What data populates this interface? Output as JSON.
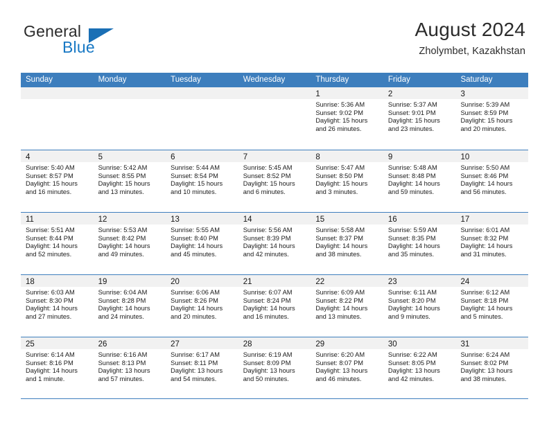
{
  "brand": {
    "name_part1": "General",
    "name_part2": "Blue",
    "logo_icon": "triangle-flag-icon",
    "blue": "#1878c4"
  },
  "header": {
    "title": "August 2024",
    "location": "Zholymbet, Kazakhstan"
  },
  "theme": {
    "header_blue": "#3d7ebd",
    "datebar_gray": "#f1f1f1",
    "text": "#1a1a1a"
  },
  "day_headers": [
    "Sunday",
    "Monday",
    "Tuesday",
    "Wednesday",
    "Thursday",
    "Friday",
    "Saturday"
  ],
  "weeks": [
    [
      {
        "day": "",
        "empty": true
      },
      {
        "day": "",
        "empty": true
      },
      {
        "day": "",
        "empty": true
      },
      {
        "day": "",
        "empty": true
      },
      {
        "day": "1",
        "sunrise": "Sunrise: 5:36 AM",
        "sunset": "Sunset: 9:02 PM",
        "daylight1": "Daylight: 15 hours",
        "daylight2": "and 26 minutes."
      },
      {
        "day": "2",
        "sunrise": "Sunrise: 5:37 AM",
        "sunset": "Sunset: 9:01 PM",
        "daylight1": "Daylight: 15 hours",
        "daylight2": "and 23 minutes."
      },
      {
        "day": "3",
        "sunrise": "Sunrise: 5:39 AM",
        "sunset": "Sunset: 8:59 PM",
        "daylight1": "Daylight: 15 hours",
        "daylight2": "and 20 minutes."
      }
    ],
    [
      {
        "day": "4",
        "sunrise": "Sunrise: 5:40 AM",
        "sunset": "Sunset: 8:57 PM",
        "daylight1": "Daylight: 15 hours",
        "daylight2": "and 16 minutes."
      },
      {
        "day": "5",
        "sunrise": "Sunrise: 5:42 AM",
        "sunset": "Sunset: 8:55 PM",
        "daylight1": "Daylight: 15 hours",
        "daylight2": "and 13 minutes."
      },
      {
        "day": "6",
        "sunrise": "Sunrise: 5:44 AM",
        "sunset": "Sunset: 8:54 PM",
        "daylight1": "Daylight: 15 hours",
        "daylight2": "and 10 minutes."
      },
      {
        "day": "7",
        "sunrise": "Sunrise: 5:45 AM",
        "sunset": "Sunset: 8:52 PM",
        "daylight1": "Daylight: 15 hours",
        "daylight2": "and 6 minutes."
      },
      {
        "day": "8",
        "sunrise": "Sunrise: 5:47 AM",
        "sunset": "Sunset: 8:50 PM",
        "daylight1": "Daylight: 15 hours",
        "daylight2": "and 3 minutes."
      },
      {
        "day": "9",
        "sunrise": "Sunrise: 5:48 AM",
        "sunset": "Sunset: 8:48 PM",
        "daylight1": "Daylight: 14 hours",
        "daylight2": "and 59 minutes."
      },
      {
        "day": "10",
        "sunrise": "Sunrise: 5:50 AM",
        "sunset": "Sunset: 8:46 PM",
        "daylight1": "Daylight: 14 hours",
        "daylight2": "and 56 minutes."
      }
    ],
    [
      {
        "day": "11",
        "sunrise": "Sunrise: 5:51 AM",
        "sunset": "Sunset: 8:44 PM",
        "daylight1": "Daylight: 14 hours",
        "daylight2": "and 52 minutes."
      },
      {
        "day": "12",
        "sunrise": "Sunrise: 5:53 AM",
        "sunset": "Sunset: 8:42 PM",
        "daylight1": "Daylight: 14 hours",
        "daylight2": "and 49 minutes."
      },
      {
        "day": "13",
        "sunrise": "Sunrise: 5:55 AM",
        "sunset": "Sunset: 8:40 PM",
        "daylight1": "Daylight: 14 hours",
        "daylight2": "and 45 minutes."
      },
      {
        "day": "14",
        "sunrise": "Sunrise: 5:56 AM",
        "sunset": "Sunset: 8:39 PM",
        "daylight1": "Daylight: 14 hours",
        "daylight2": "and 42 minutes."
      },
      {
        "day": "15",
        "sunrise": "Sunrise: 5:58 AM",
        "sunset": "Sunset: 8:37 PM",
        "daylight1": "Daylight: 14 hours",
        "daylight2": "and 38 minutes."
      },
      {
        "day": "16",
        "sunrise": "Sunrise: 5:59 AM",
        "sunset": "Sunset: 8:35 PM",
        "daylight1": "Daylight: 14 hours",
        "daylight2": "and 35 minutes."
      },
      {
        "day": "17",
        "sunrise": "Sunrise: 6:01 AM",
        "sunset": "Sunset: 8:32 PM",
        "daylight1": "Daylight: 14 hours",
        "daylight2": "and 31 minutes."
      }
    ],
    [
      {
        "day": "18",
        "sunrise": "Sunrise: 6:03 AM",
        "sunset": "Sunset: 8:30 PM",
        "daylight1": "Daylight: 14 hours",
        "daylight2": "and 27 minutes."
      },
      {
        "day": "19",
        "sunrise": "Sunrise: 6:04 AM",
        "sunset": "Sunset: 8:28 PM",
        "daylight1": "Daylight: 14 hours",
        "daylight2": "and 24 minutes."
      },
      {
        "day": "20",
        "sunrise": "Sunrise: 6:06 AM",
        "sunset": "Sunset: 8:26 PM",
        "daylight1": "Daylight: 14 hours",
        "daylight2": "and 20 minutes."
      },
      {
        "day": "21",
        "sunrise": "Sunrise: 6:07 AM",
        "sunset": "Sunset: 8:24 PM",
        "daylight1": "Daylight: 14 hours",
        "daylight2": "and 16 minutes."
      },
      {
        "day": "22",
        "sunrise": "Sunrise: 6:09 AM",
        "sunset": "Sunset: 8:22 PM",
        "daylight1": "Daylight: 14 hours",
        "daylight2": "and 13 minutes."
      },
      {
        "day": "23",
        "sunrise": "Sunrise: 6:11 AM",
        "sunset": "Sunset: 8:20 PM",
        "daylight1": "Daylight: 14 hours",
        "daylight2": "and 9 minutes."
      },
      {
        "day": "24",
        "sunrise": "Sunrise: 6:12 AM",
        "sunset": "Sunset: 8:18 PM",
        "daylight1": "Daylight: 14 hours",
        "daylight2": "and 5 minutes."
      }
    ],
    [
      {
        "day": "25",
        "sunrise": "Sunrise: 6:14 AM",
        "sunset": "Sunset: 8:16 PM",
        "daylight1": "Daylight: 14 hours",
        "daylight2": "and 1 minute."
      },
      {
        "day": "26",
        "sunrise": "Sunrise: 6:16 AM",
        "sunset": "Sunset: 8:13 PM",
        "daylight1": "Daylight: 13 hours",
        "daylight2": "and 57 minutes."
      },
      {
        "day": "27",
        "sunrise": "Sunrise: 6:17 AM",
        "sunset": "Sunset: 8:11 PM",
        "daylight1": "Daylight: 13 hours",
        "daylight2": "and 54 minutes."
      },
      {
        "day": "28",
        "sunrise": "Sunrise: 6:19 AM",
        "sunset": "Sunset: 8:09 PM",
        "daylight1": "Daylight: 13 hours",
        "daylight2": "and 50 minutes."
      },
      {
        "day": "29",
        "sunrise": "Sunrise: 6:20 AM",
        "sunset": "Sunset: 8:07 PM",
        "daylight1": "Daylight: 13 hours",
        "daylight2": "and 46 minutes."
      },
      {
        "day": "30",
        "sunrise": "Sunrise: 6:22 AM",
        "sunset": "Sunset: 8:05 PM",
        "daylight1": "Daylight: 13 hours",
        "daylight2": "and 42 minutes."
      },
      {
        "day": "31",
        "sunrise": "Sunrise: 6:24 AM",
        "sunset": "Sunset: 8:02 PM",
        "daylight1": "Daylight: 13 hours",
        "daylight2": "and 38 minutes."
      }
    ]
  ]
}
